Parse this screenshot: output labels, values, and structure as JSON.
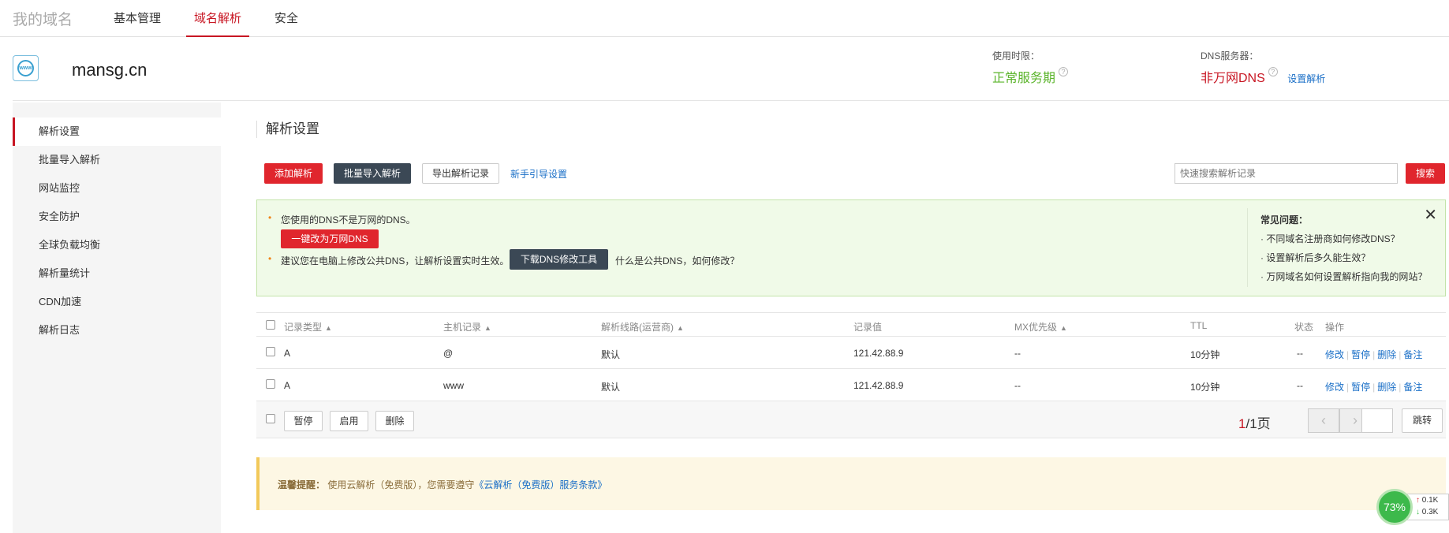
{
  "nav": {
    "brand": "我的域名",
    "tabs": [
      "基本管理",
      "域名解析",
      "安全"
    ]
  },
  "domain": {
    "name": "mansg.cn",
    "usage_label": "使用时限：",
    "usage_value": "正常服务期",
    "dns_label": "DNS服务器：",
    "dns_value": "非万网DNS",
    "dns_link": "设置解析",
    "help_mark": "?"
  },
  "sidebar": {
    "items": [
      "解析设置",
      "批量导入解析",
      "网站监控",
      "安全防护",
      "全球负载均衡",
      "解析量统计",
      "CDN加速",
      "解析日志"
    ]
  },
  "main": {
    "title": "解析设置",
    "toolbar": {
      "add": "添加解析",
      "batch_import": "批量导入解析",
      "export": "导出解析记录",
      "guide": "新手引导设置",
      "search_placeholder": "快速搜索解析记录",
      "search_btn": "搜索"
    }
  },
  "notice": {
    "line1": "您使用的DNS不是万网的DNS。",
    "switch_btn": "一键改为万网DNS",
    "line2": "建议您在电脑上修改公共DNS，让解析设置实时生效。",
    "download_btn": "下载DNS修改工具",
    "public_dns_link": "什么是公共DNS，如何修改？",
    "faq_title": "常见问题：",
    "faq": [
      "· 不同域名注册商如何修改DNS？",
      "· 设置解析后多久能生效？",
      "· 万网域名如何设置解析指向我的网站？"
    ],
    "close": "✕"
  },
  "table": {
    "sort_arrow": "▲",
    "headers": [
      "记录类型",
      "主机记录",
      "解析线路(运营商)",
      "记录值",
      "MX优先级",
      "TTL",
      "状态",
      "操作"
    ],
    "rows": [
      {
        "type": "A",
        "host": "@",
        "line": "默认",
        "value": "121.42.88.9",
        "mx": "--",
        "ttl": "10分钟",
        "status": "--"
      },
      {
        "type": "A",
        "host": "www",
        "line": "默认",
        "value": "121.42.88.9",
        "mx": "--",
        "ttl": "10分钟",
        "status": "--"
      }
    ],
    "ops": [
      "修改",
      "暂停",
      "删除",
      "备注"
    ],
    "op_sep": "|"
  },
  "footer": {
    "pause": "暂停",
    "enable": "启用",
    "delete": "删除",
    "page_current": "1",
    "page_total": "/1页",
    "prev": "‹",
    "next": "›",
    "jump": "跳转"
  },
  "reminder": {
    "label": "温馨提醒：",
    "text": "使用云解析（免费版），您需要遵守",
    "link": "《云解析（免费版）服务条款》"
  },
  "speed": {
    "percent": "73%",
    "up_arrow": "↑",
    "up": "0.1K",
    "down_arrow": "↓",
    "down": "0.3K"
  }
}
